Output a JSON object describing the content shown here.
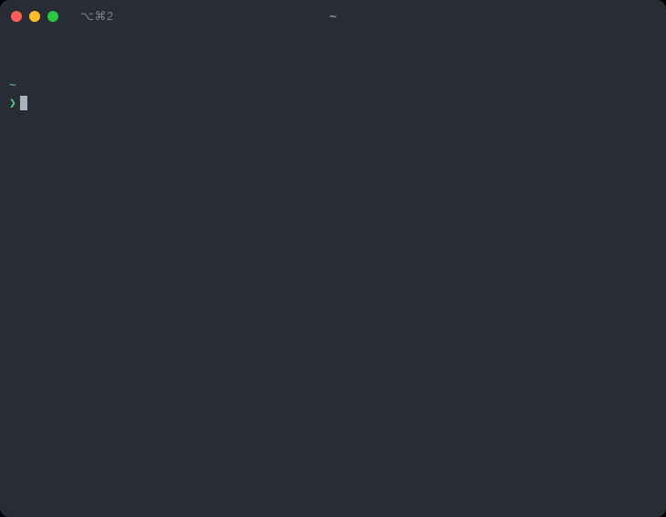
{
  "titlebar": {
    "shortcut": "⌥⌘2",
    "title": "~"
  },
  "terminal": {
    "cwd": "~",
    "prompt_symbol": "❯"
  }
}
